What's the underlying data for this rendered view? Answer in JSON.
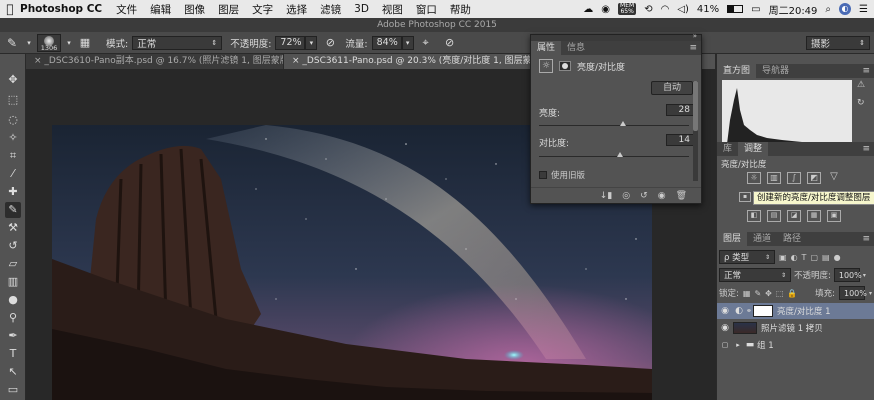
{
  "menubar": {
    "apple": "",
    "app_name": "Photoshop CC",
    "items": [
      "文件",
      "编辑",
      "图像",
      "图层",
      "文字",
      "选择",
      "滤镜",
      "3D",
      "视图",
      "窗口",
      "帮助"
    ],
    "mem": "MEM\n65%",
    "battery": "41%",
    "clock": "周二20:49"
  },
  "window_title": "Adobe Photoshop CC 2015",
  "options": {
    "brush_size": "1306",
    "mode_label": "模式:",
    "mode_value": "正常",
    "opacity_label": "不透明度:",
    "opacity_value": "72%",
    "flow_label": "流量:",
    "flow_value": "84%",
    "workspace": "摄影"
  },
  "doc_tabs": [
    {
      "label": "_DSC3610-Pano副本.psd @ 16.7% (照片滤镜 1, 图层蒙版/16) *",
      "active": false
    },
    {
      "label": "_DSC3611-Pano.psd @ 20.3% (亮度/对比度 1, 图层蒙版/16)",
      "active": true
    }
  ],
  "properties": {
    "tab1": "属性",
    "tab2": "信息",
    "title": "亮度/对比度",
    "auto_button": "自动",
    "brightness_label": "亮度:",
    "brightness_value": "28",
    "contrast_label": "对比度:",
    "contrast_value": "14",
    "legacy_label": "使用旧版"
  },
  "histogram": {
    "tab1": "直方图",
    "tab2": "导航器"
  },
  "adjustments": {
    "tab1": "库",
    "tab2": "调整",
    "header": "亮度/对比度",
    "tooltip": "创建新的亮度/对比度调整图层"
  },
  "layers": {
    "tab1": "图层",
    "tab2": "通道",
    "tab3": "路径",
    "filter_kind": "ρ 类型",
    "blend_mode": "正常",
    "opacity_label": "不透明度:",
    "opacity_value": "100%",
    "lock_label": "锁定:",
    "fill_label": "填充:",
    "fill_value": "100%",
    "items": [
      {
        "name": "亮度/对比度 1",
        "selected": true
      },
      {
        "name": "照片滤镜 1 拷贝",
        "selected": false
      },
      {
        "name": "组 1",
        "selected": false
      }
    ]
  }
}
